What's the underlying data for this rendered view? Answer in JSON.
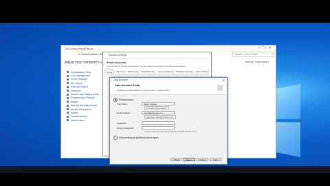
{
  "control_panel": {
    "window_title": "All Control Panel Items",
    "breadcrumb": "« Control Panel › All Control Panel Items",
    "search_placeholder": "Search Control Panel",
    "heading": "Adjust your computer's settings",
    "view_by": "View by:  Small icons ▾",
    "items": [
      "Administrative Tools",
      "Color Management",
      "Device Manager",
      "File History",
      "Indexing Options",
      "Keyboard",
      "Network and Sharing Center",
      "Programs and Features",
      "Region",
      "Security and Maintenance",
      "Speech Recognition",
      "System",
      "Troubleshooting",
      "Work Folders"
    ]
  },
  "account_settings": {
    "window_title": "Account Settings",
    "heading": "Email Accounts",
    "subheading": "You can add or remove an account. You can select an account and change its settings.",
    "tabs": [
      "Email",
      "Data Files",
      "RSS Feeds",
      "SharePoint Lists",
      "Internet Calendars",
      "Published Calendars",
      "Address Books"
    ]
  },
  "add_account": {
    "window_title": "Add Account",
    "close": "✕",
    "heading": "Auto Account Setup",
    "subheading": "Outlook can automatically configure many email accounts.",
    "option_email": "Email Account",
    "your_name_label": "Your Name:",
    "your_name_value": "Sarah Dupage",
    "your_name_hint": "Example: Ellen Adams",
    "email_label": "Email Address:",
    "email_value": "sarah@example.com",
    "email_hint": "Example: ellen@contoso.com",
    "password_label": "Password:",
    "retype_label": "Retype Password:",
    "password_help": "Type the password your Internet service provider has given you.",
    "option_manual": "Manual setup or additional server types",
    "buttons": {
      "back": "< Back",
      "next": "Next >",
      "cancel": "Cancel",
      "help": "Help"
    }
  }
}
